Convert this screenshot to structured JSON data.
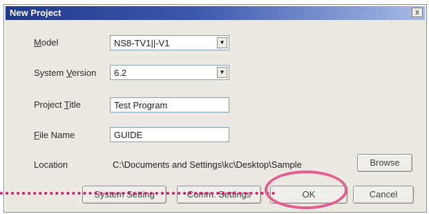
{
  "dialog": {
    "title": "New Project",
    "close_label": "x"
  },
  "fields": {
    "model": {
      "label_pre": "",
      "label_key": "M",
      "label_post": "odel",
      "value": "NS8-TV1||-V1"
    },
    "system_version": {
      "label_pre": "System ",
      "label_key": "V",
      "label_post": "ersion",
      "value": "6.2"
    },
    "project_title": {
      "label_pre": "Project ",
      "label_key": "T",
      "label_post": "itle",
      "value": "Test Program"
    },
    "file_name": {
      "label_pre": "",
      "label_key": "F",
      "label_post": "ile Name",
      "value": "GUIDE"
    },
    "location": {
      "label": "Location",
      "value": "C:\\Documents and Settings\\kc\\Desktop\\Sample"
    }
  },
  "buttons": {
    "browse": "Browse",
    "system_setting": "System Setting",
    "comm_settings": "Comm. Settings",
    "ok": "OK",
    "cancel": "Cancel"
  },
  "icons": {
    "close": "close-icon",
    "dropdown": "chevron-down-icon"
  },
  "colors": {
    "callout": "#e0106b",
    "highlight_ring": "#e35e8f",
    "titlebar": "#223a8c"
  }
}
